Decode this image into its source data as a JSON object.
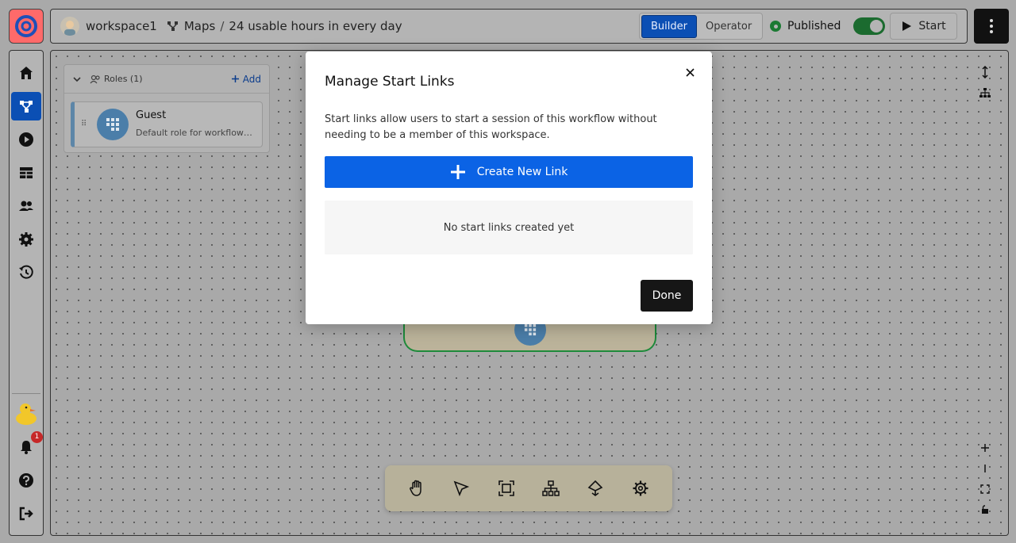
{
  "header": {
    "workspace_name": "workspace1",
    "breadcrumb_section": "Maps",
    "breadcrumb_separator": "/",
    "breadcrumb_page": "24 usable hours in every day",
    "mode_builder": "Builder",
    "mode_operator": "Operator",
    "status_label": "Published",
    "start_label": "Start",
    "accent_color": "#0b4fb4",
    "published_color": "#1b7a33"
  },
  "sidebar": {
    "items": [
      {
        "icon": "home-icon"
      },
      {
        "icon": "workflow-icon"
      },
      {
        "icon": "play-icon"
      },
      {
        "icon": "table-icon"
      },
      {
        "icon": "users-icon"
      },
      {
        "icon": "gear-icon"
      },
      {
        "icon": "history-icon"
      }
    ],
    "notification_count": "1"
  },
  "roles_panel": {
    "title": "Roles (1)",
    "add_label": "Add",
    "roles": [
      {
        "name": "Guest",
        "description": "Default role for workflow p..."
      }
    ]
  },
  "modal": {
    "title": "Manage Start Links",
    "description": "Start links allow users to start a session of this workflow without needing to be a member of this workspace.",
    "create_label": "Create New Link",
    "empty_text": "No start links created yet",
    "done_label": "Done",
    "primary_color": "#0b63e5"
  },
  "toolbar": {
    "tools": [
      "hand-icon",
      "pointer-icon",
      "frame-icon",
      "hierarchy-icon",
      "branch-icon",
      "gear-icon"
    ]
  }
}
